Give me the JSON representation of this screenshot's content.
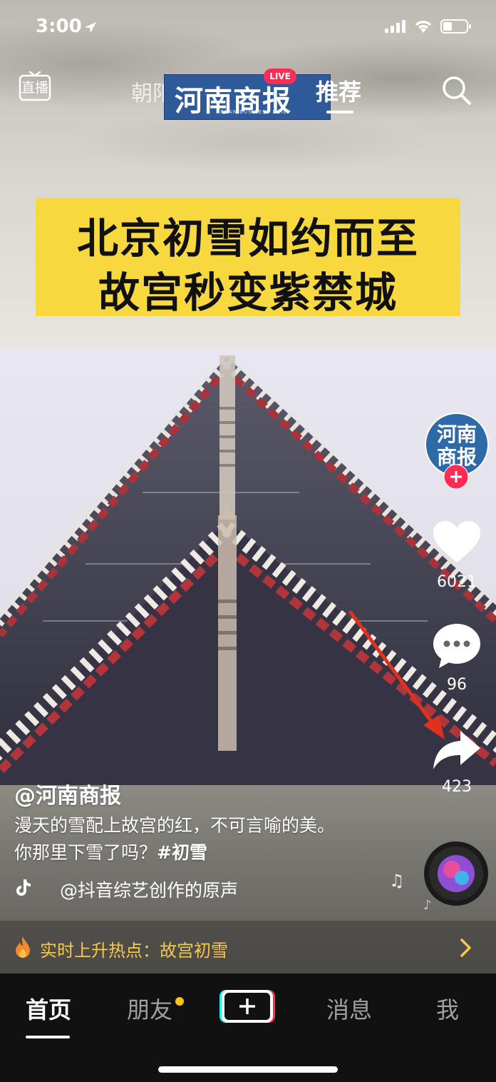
{
  "status_bar": {
    "time": "3:00"
  },
  "top_nav": {
    "live_entry_label": "直播",
    "location_tab": "朝阳",
    "recommend_tab": "推荐",
    "live_badge": "LIVE"
  },
  "brand_banner": {
    "text": "河南商报",
    "subtitle": "HENAN BUSINESS DAILY"
  },
  "title_card": {
    "line1": "北京初雪如约而至",
    "line2": "故宫秒变紫禁城"
  },
  "action_rail": {
    "avatar_text_top": "河南",
    "avatar_text_bottom": "商报",
    "like_count": "6021",
    "comment_count": "96",
    "share_count": "423"
  },
  "caption": {
    "author": "@河南商报",
    "text": "漫天的雪配上故宫的红，不可言喻的美。你那里下雪了吗？",
    "hashtag": "#初雪",
    "music": "@抖音综艺创作的原声"
  },
  "hot_topic": {
    "label": "实时上升热点：故宫初雪"
  },
  "tab_bar": {
    "home": "首页",
    "friends": "朋友",
    "inbox": "消息",
    "me": "我"
  },
  "colors": {
    "accent_red": "#fe2c55",
    "title_yellow": "#f7d93f",
    "hot_text": "#f7c94a",
    "friends_dot": "#f5c518",
    "avatar_blue": "#2f6aa8"
  }
}
